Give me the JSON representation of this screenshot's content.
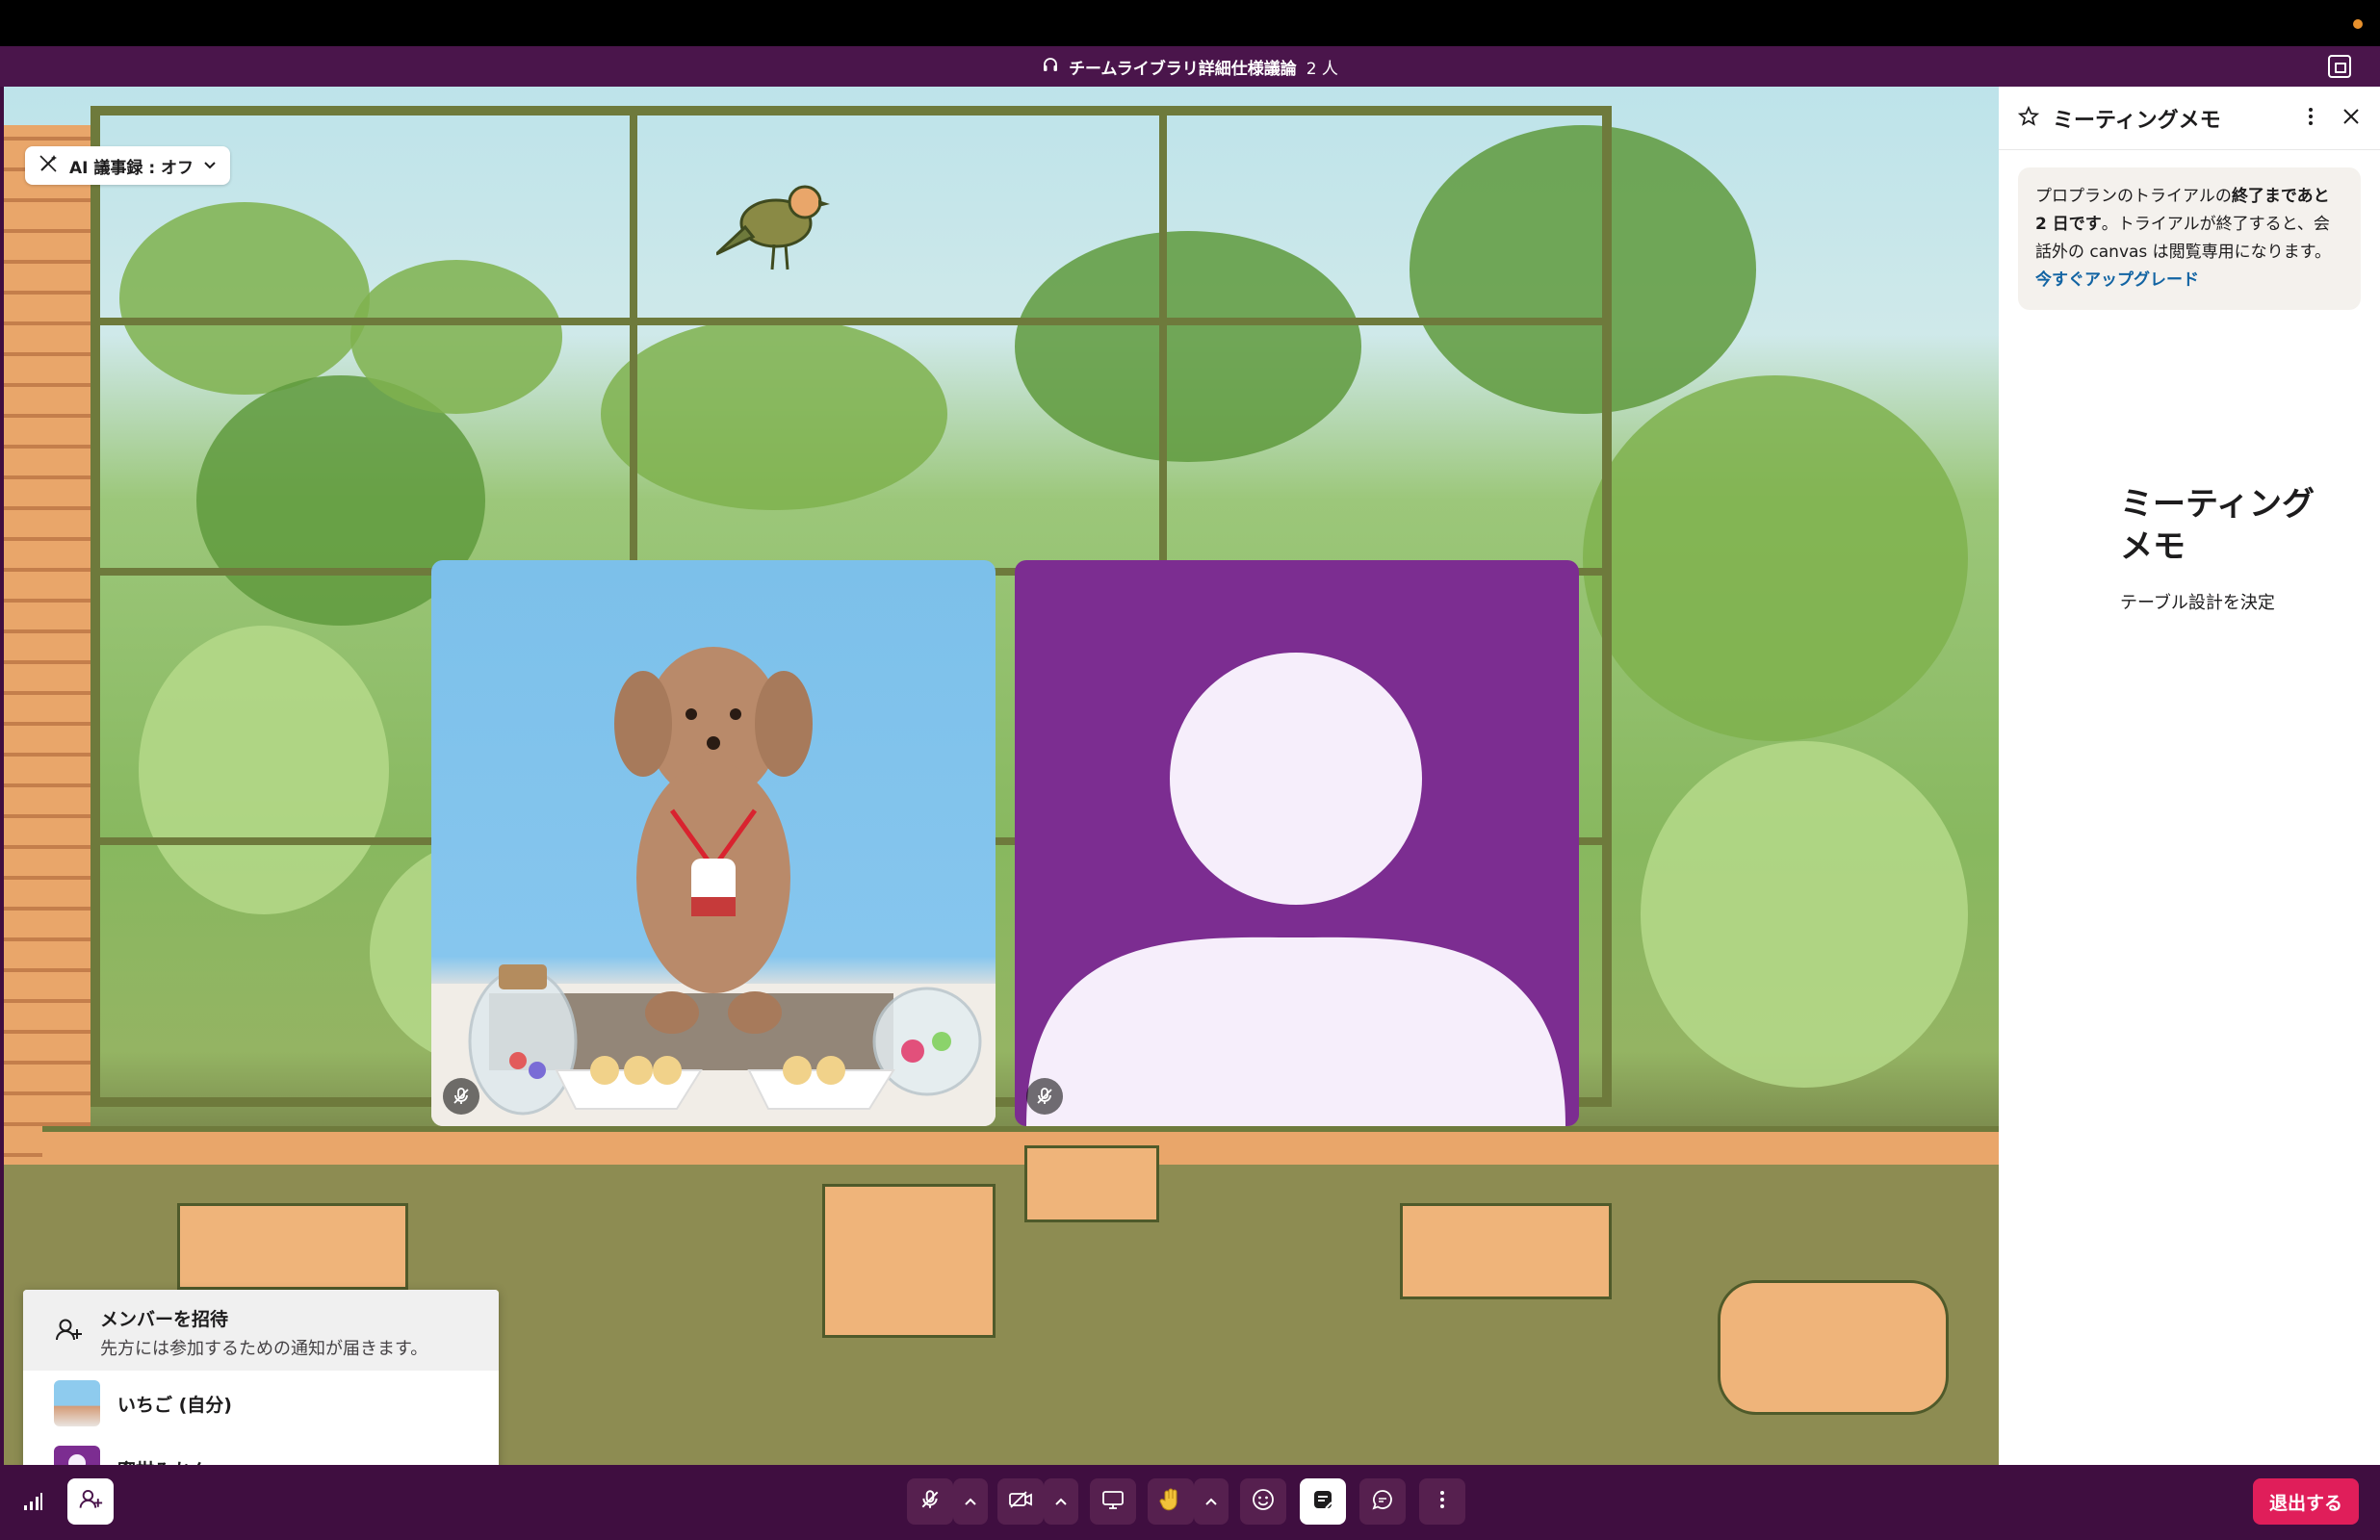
{
  "window": {
    "title": "チームライブラリ詳細仕様議論",
    "participant_count": "2 人"
  },
  "ai_notes": {
    "label": "AI 議事録 : オフ"
  },
  "memo_panel": {
    "title": "ミーティングメモ",
    "notice_prefix": "プロプランのトライアルの",
    "notice_bold": "終了まであと 2 日です",
    "notice_suffix": "。トライアルが終了すると、会話外の canvas は閲覧専用になります。",
    "upgrade_link": "今すぐアップグレード",
    "memo_heading": "ミーティングメモ",
    "memo_line": "テーブル設計を決定"
  },
  "invite_menu": {
    "invite_title": "メンバーを招待",
    "invite_desc": "先方には参加するための通知が届きます。",
    "members": [
      {
        "name": "いちご (自分)"
      },
      {
        "name": "蜜柑みかん"
      }
    ]
  },
  "toolbar": {
    "leave_label": "退出する"
  },
  "colors": {
    "aubergine": "#4a154b",
    "leave_red": "#e01e5a",
    "tile_purple": "#7c2d91",
    "link_blue": "#1264a3"
  },
  "icons": [
    "headphones-icon",
    "popout-icon",
    "ai-sparkle-icon",
    "chevron-down-icon",
    "star-icon",
    "more-vertical-icon",
    "close-icon",
    "mic-off-icon",
    "add-user-icon",
    "stats-icon",
    "camera-off-icon",
    "screen-share-icon",
    "raise-hand-icon",
    "emoji-icon",
    "notes-icon",
    "chat-icon",
    "more-icon"
  ]
}
